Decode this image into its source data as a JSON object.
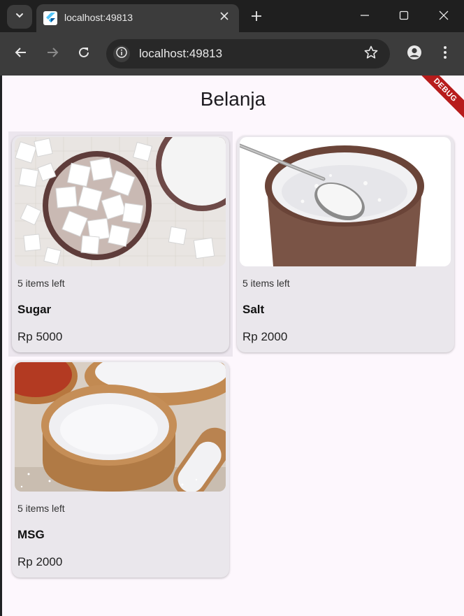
{
  "browser": {
    "tab_title": "localhost:49813",
    "url": "localhost:49813",
    "icons": {
      "tab_search": "chevron-down-icon",
      "favicon": "flutter-icon",
      "close_tab": "close-icon",
      "new_tab": "plus-icon",
      "minimize": "minimize-icon",
      "maximize": "maximize-icon",
      "close_window": "close-icon",
      "back": "arrow-left-icon",
      "forward": "arrow-right-icon",
      "reload": "reload-icon",
      "site_info": "info-icon",
      "bookmark": "star-icon",
      "profile": "account-icon",
      "menu": "more-vert-icon"
    }
  },
  "app": {
    "title": "Belanja",
    "debug_banner": "DEBUG",
    "colors": {
      "background": "#fdf7fd",
      "card": "#eae7ec",
      "debug": "#b71c1c"
    },
    "products": [
      {
        "stock": "5 items left",
        "name": "Sugar",
        "price": "Rp 5000",
        "image": "sugar-cubes-image"
      },
      {
        "stock": "5 items left",
        "name": "Salt",
        "price": "Rp 2000",
        "image": "salt-bowl-image"
      },
      {
        "stock": "5 items left",
        "name": "MSG",
        "price": "Rp 2000",
        "image": "msg-bowl-image"
      }
    ]
  }
}
